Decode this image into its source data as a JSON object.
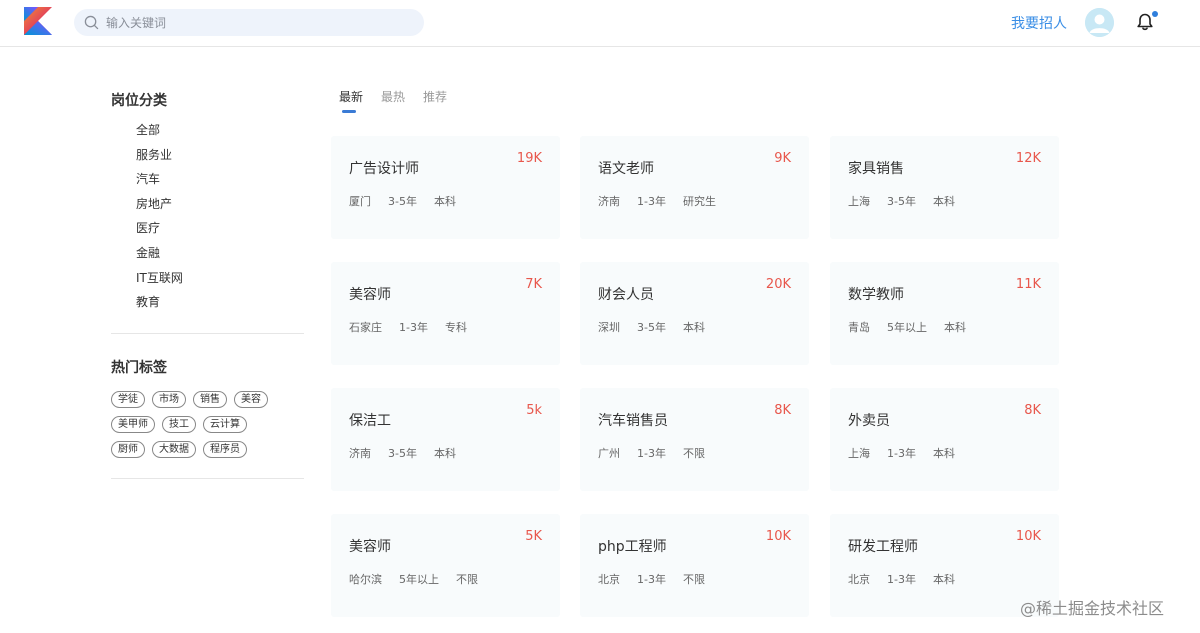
{
  "header": {
    "search_placeholder": "输入关键词",
    "recruit_label": "我要招人"
  },
  "sidebar": {
    "category_title": "岗位分类",
    "categories": [
      "全部",
      "服务业",
      "汽车",
      "房地产",
      "医疗",
      "金融",
      "IT互联网",
      "教育"
    ],
    "hot_title": "热门标签",
    "tag_rows": [
      [
        "学徒",
        "市场",
        "销售",
        "美容"
      ],
      [
        "美甲师",
        "技工",
        "云计算"
      ],
      [
        "厨师",
        "大数据",
        "程序员"
      ]
    ]
  },
  "tabs": [
    {
      "label": "最新",
      "active": true
    },
    {
      "label": "最热",
      "active": false
    },
    {
      "label": "推荐",
      "active": false
    }
  ],
  "jobs": [
    {
      "title": "广告设计师",
      "salary": "19K",
      "city": "厦门",
      "experience": "3-5年",
      "education": "本科"
    },
    {
      "title": "语文老师",
      "salary": "9K",
      "city": "济南",
      "experience": "1-3年",
      "education": "研究生"
    },
    {
      "title": "家具销售",
      "salary": "12K",
      "city": "上海",
      "experience": "3-5年",
      "education": "本科"
    },
    {
      "title": "美容师",
      "salary": "7K",
      "city": "石家庄",
      "experience": "1-3年",
      "education": "专科"
    },
    {
      "title": "财会人员",
      "salary": "20K",
      "city": "深圳",
      "experience": "3-5年",
      "education": "本科"
    },
    {
      "title": "数学教师",
      "salary": "11K",
      "city": "青岛",
      "experience": "5年以上",
      "education": "本科"
    },
    {
      "title": "保洁工",
      "salary": "5k",
      "city": "济南",
      "experience": "3-5年",
      "education": "本科"
    },
    {
      "title": "汽车销售员",
      "salary": "8K",
      "city": "广州",
      "experience": "1-3年",
      "education": "不限"
    },
    {
      "title": "外卖员",
      "salary": "8K",
      "city": "上海",
      "experience": "1-3年",
      "education": "本科"
    },
    {
      "title": "美容师",
      "salary": "5K",
      "city": "哈尔滨",
      "experience": "5年以上",
      "education": "不限"
    },
    {
      "title": "php工程师",
      "salary": "10K",
      "city": "北京",
      "experience": "1-3年",
      "education": "不限"
    },
    {
      "title": "研发工程师",
      "salary": "10K",
      "city": "北京",
      "experience": "1-3年",
      "education": "本科"
    }
  ],
  "watermark": "@稀土掘金技术社区",
  "colors": {
    "accent": "#3a8ee6",
    "salary": "#e8574c",
    "card_bg": "#f8fbfc",
    "search_bg": "#eef3fb"
  }
}
